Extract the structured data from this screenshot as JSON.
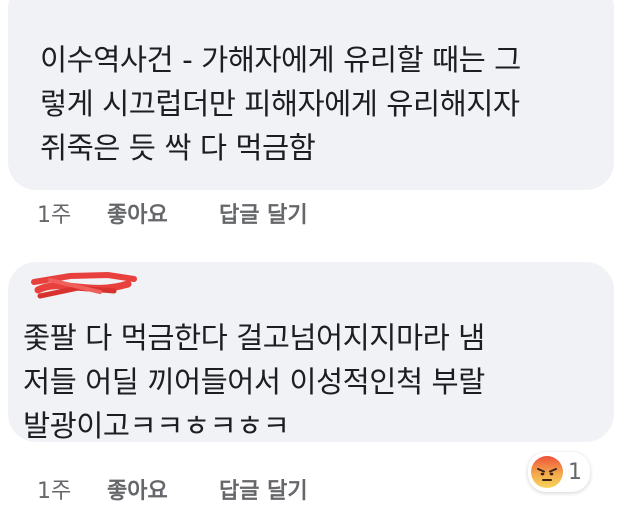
{
  "comments": [
    {
      "text": "이수역사건 - 가해자에게 유리할 때는 그\n렇게 시끄럽더만 피해자에게 유리해지자\n쥐죽은 듯 싹 다 먹금함",
      "time": "1주",
      "like_label": "좋아요",
      "reply_label": "답글 달기"
    },
    {
      "text": "좇팔 다 먹금한다 걸고넘어지지마라 냄\n저들 어딜 끼어들어서 이성적인척 부랄\n발광이고ㅋㅋㅎㅋㅎㅋ",
      "time": "1주",
      "like_label": "좋아요",
      "reply_label": "답글 달기",
      "reaction": {
        "icon": "angry-emoji-icon",
        "count": "1"
      }
    }
  ],
  "colors": {
    "bubble": "#f0f2f5",
    "text": "#1c1e21",
    "meta": "#65676b",
    "redaction": "#e8413d"
  }
}
